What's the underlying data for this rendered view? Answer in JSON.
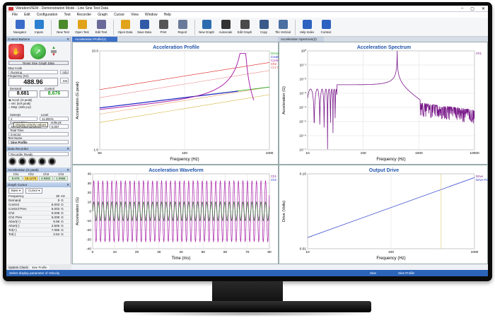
{
  "window": {
    "title": "VibrationVIEW - Demonstration Mode - Line Sine Test Data",
    "min": "–",
    "max": "▢",
    "close": "✕"
  },
  "menu": [
    "File",
    "Edit",
    "Configuration",
    "Test",
    "Recorder",
    "Graph",
    "Cursor",
    "View",
    "Window",
    "Help"
  ],
  "toolbar": [
    {
      "label": "Navigator",
      "color": "#3a6bc9"
    },
    {
      "label": "Inputs",
      "color": "#2d7fd0"
    },
    {
      "label": "New Test",
      "color": "#4a8a2a"
    },
    {
      "label": "Open Test",
      "color": "#e0a31a"
    },
    {
      "label": "Edit Test",
      "color": "#6a6a9a"
    },
    {
      "label": "Open Data",
      "color": "#e0a31a"
    },
    {
      "label": "Save Data",
      "color": "#3059a8"
    },
    {
      "label": "Print",
      "color": "#555"
    },
    {
      "label": "Report",
      "color": "#6a7a9a"
    },
    {
      "label": "New Graph",
      "color": "#2b6cb0"
    },
    {
      "label": "Autoscale",
      "color": "#333"
    },
    {
      "label": "Edit Graph",
      "color": "#4a4a4a"
    },
    {
      "label": "Copy",
      "color": "#3a5a8a"
    },
    {
      "label": "Tile Vertical",
      "color": "#4a6fa0"
    },
    {
      "label": "Help Index",
      "color": "#2d62c0"
    },
    {
      "label": "Context",
      "color": "#2d62c0"
    }
  ],
  "control": {
    "header": "Control Buttons",
    "reset": "Reset Sine Graph Data",
    "step_code_label": "Step Code",
    "step_code": "Running",
    "info": "Info",
    "freq_label": "Frequency (Hz)",
    "freq": "488.96",
    "set": "Set",
    "demand_label": "Demand",
    "demand": "8.681",
    "control_label": "Control",
    "control": "8.676",
    "accel_opt": "Accel. (G peak)",
    "vel_opt": "Vel. (in/s peak)",
    "disp_opt": "Disp. (mils p-p)",
    "tooltip": "Display velocity values",
    "sweeps_label": "Sweeps",
    "sweeps": "2",
    "level_label": "Level",
    "level": "11.000%",
    "cur_time_label": "Current Time",
    "cur_time": "Jan 15, 2020 12:53:05",
    "drive_label": "Volts pk",
    "drive": "0.007",
    "total_time_label": "Total Time",
    "total_time": "0:04:52",
    "test_name_label": "Test Name",
    "test_name": "Sine Profile"
  },
  "recorder": {
    "header": "Data Recorder",
    "status": "Recorder Ready"
  },
  "accel_table": {
    "header": "Acceleration (G peak)",
    "cols": [
      "Ch1",
      "Ch2",
      "Ch3",
      "Ch4"
    ],
    "vals": [
      "8.676",
      "15.1275",
      "4.9382",
      "1.0965"
    ]
  },
  "graph_cursor": {
    "header": "Graph Cursor",
    "base": "Base",
    "cursor": "Cursor",
    "rows": [
      [
        "Frequency",
        "30",
        "Hz"
      ],
      [
        "Demand",
        "5",
        "G"
      ],
      [
        "Control",
        "5.003",
        "G"
      ],
      [
        "Control Prev",
        "5.003",
        "G"
      ],
      [
        "Ch2",
        "5.008",
        "G"
      ],
      [
        "Ch2 Prev",
        "5.008",
        "G"
      ],
      [
        "Abort(+)",
        "9.98",
        "G"
      ],
      [
        "Abort(-)",
        "2.506",
        "G"
      ],
      [
        "Tol(+)",
        "7.065",
        "G"
      ],
      [
        "Tol(-)",
        "3.54",
        "G"
      ]
    ]
  },
  "left_tabs": [
    "System Check",
    "Sine Profile"
  ],
  "status": {
    "left": "Select display parameter of Velocity",
    "mid": "Sine",
    "right": "Sine Profile"
  },
  "doc_tabs": [
    "Acceleration Profile(1)",
    "Acceleration Spectrum(2)"
  ],
  "chart_data": [
    {
      "type": "line",
      "title": "Acceleration Profile",
      "xlabel": "Frequency (Hz)",
      "ylabel": "Acceleration (G peak)",
      "xlim": [
        20,
        1000
      ],
      "xscale": "log",
      "yscale": "log",
      "xticks": [
        "50",
        "100",
        "1000"
      ],
      "yticks": [
        "10.0",
        "1.0"
      ],
      "legend": [
        "Demand",
        "Control",
        "Control Prev",
        "Ch2",
        "Ch2 Prev"
      ],
      "legend_colors": [
        "#22aa22",
        "#2222cc",
        "#aa22aa",
        "#dd2222",
        "#dd6666"
      ]
    },
    {
      "type": "line",
      "title": "Acceleration Spectrum",
      "xlabel": "Frequency (Hz)",
      "ylabel": "Acceleration (G)",
      "xscale": "log",
      "yscale": "log",
      "xticks": [
        "10",
        "100",
        "1000",
        "10000"
      ],
      "yticks": [
        "10⁰",
        "10⁻¹",
        "10⁻²",
        "10⁻³",
        "10⁻⁴",
        "10⁻⁵",
        "10⁻⁶",
        "10⁻⁷"
      ],
      "legend": [
        "Ch1"
      ]
    },
    {
      "type": "line",
      "title": "Acceleration Waveform",
      "xlabel": "Time (ms)",
      "ylabel": "Acceleration (G)",
      "xlim": [
        0,
        80
      ],
      "ylim": [
        -40,
        40
      ],
      "xticks": [
        "0",
        "10",
        "20",
        "30",
        "40",
        "50",
        "60",
        "70",
        "80"
      ],
      "yticks": [
        "40",
        "30",
        "20",
        "10",
        "0",
        "-10",
        "-20",
        "-30",
        "-40"
      ],
      "legend": [
        "Ch1",
        "Ch2"
      ]
    },
    {
      "type": "line",
      "title": "Output Drive",
      "xlabel": "Frequency (Hz)",
      "ylabel": "Drive (Volts)",
      "xscale": "log",
      "yscale": "log",
      "xticks": [
        "10",
        "100",
        "1000"
      ],
      "yticks": [
        "0.10",
        "0.01"
      ],
      "legend": [
        "Drive",
        "Drive Prev"
      ]
    }
  ]
}
